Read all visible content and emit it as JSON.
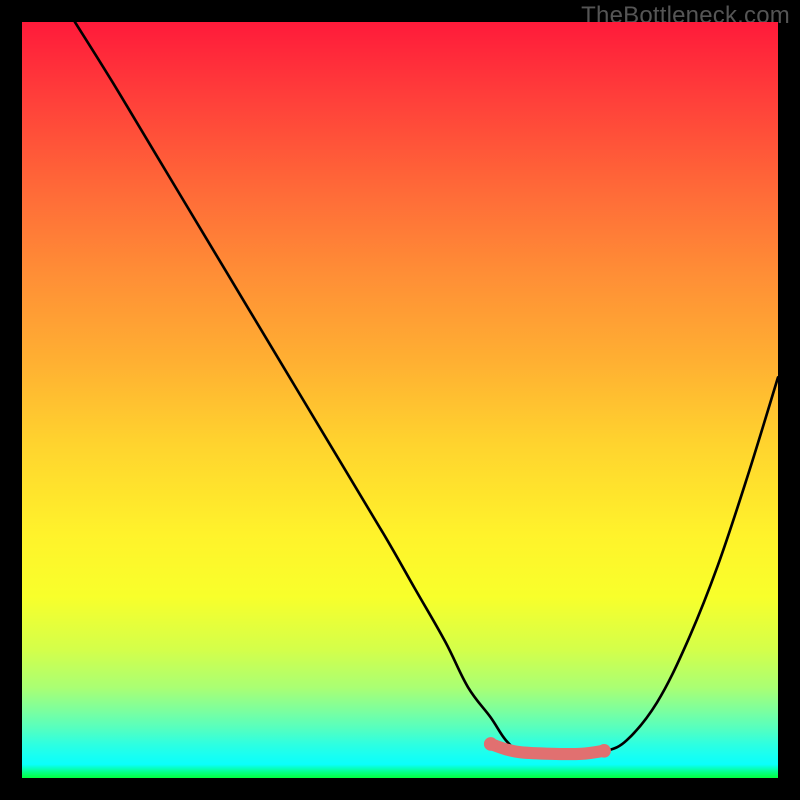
{
  "watermark": "TheBottleneck.com",
  "chart_data": {
    "type": "line",
    "title": "",
    "xlabel": "",
    "ylabel": "",
    "xlim": [
      0,
      100
    ],
    "ylim": [
      0,
      100
    ],
    "gradient_stops": [
      {
        "pct": 0,
        "color": "#ff1a3a"
      },
      {
        "pct": 9,
        "color": "#ff3b3a"
      },
      {
        "pct": 22,
        "color": "#ff6938"
      },
      {
        "pct": 33,
        "color": "#ff8d36"
      },
      {
        "pct": 45,
        "color": "#ffb032"
      },
      {
        "pct": 56,
        "color": "#ffd42e"
      },
      {
        "pct": 68,
        "color": "#fff32b"
      },
      {
        "pct": 76,
        "color": "#f8ff2b"
      },
      {
        "pct": 83,
        "color": "#d4ff4a"
      },
      {
        "pct": 88,
        "color": "#aaff73"
      },
      {
        "pct": 91,
        "color": "#7dff9d"
      },
      {
        "pct": 93.5,
        "color": "#54ffc1"
      },
      {
        "pct": 95.5,
        "color": "#2effe0"
      },
      {
        "pct": 97,
        "color": "#18fff2"
      },
      {
        "pct": 98.2,
        "color": "#0bfffb"
      },
      {
        "pct": 99.2,
        "color": "#05ff8a"
      },
      {
        "pct": 100,
        "color": "#02ff40"
      }
    ],
    "series": [
      {
        "name": "curve",
        "color": "#000000",
        "x": [
          7,
          12,
          18,
          24,
          30,
          36,
          42,
          48,
          52,
          56,
          59,
          62,
          64,
          66,
          70,
          74,
          77,
          80,
          84,
          88,
          92,
          96,
          100
        ],
        "y": [
          100,
          92,
          82,
          72,
          62,
          52,
          42,
          32,
          25,
          18,
          12,
          8,
          5,
          3.5,
          3,
          3,
          3.5,
          5,
          10,
          18,
          28,
          40,
          53
        ]
      },
      {
        "name": "flat-highlight",
        "color": "#e17070",
        "x": [
          62,
          64,
          66,
          70,
          74,
          77
        ],
        "y": [
          4.5,
          3.8,
          3.4,
          3.2,
          3.2,
          3.6
        ]
      }
    ]
  }
}
